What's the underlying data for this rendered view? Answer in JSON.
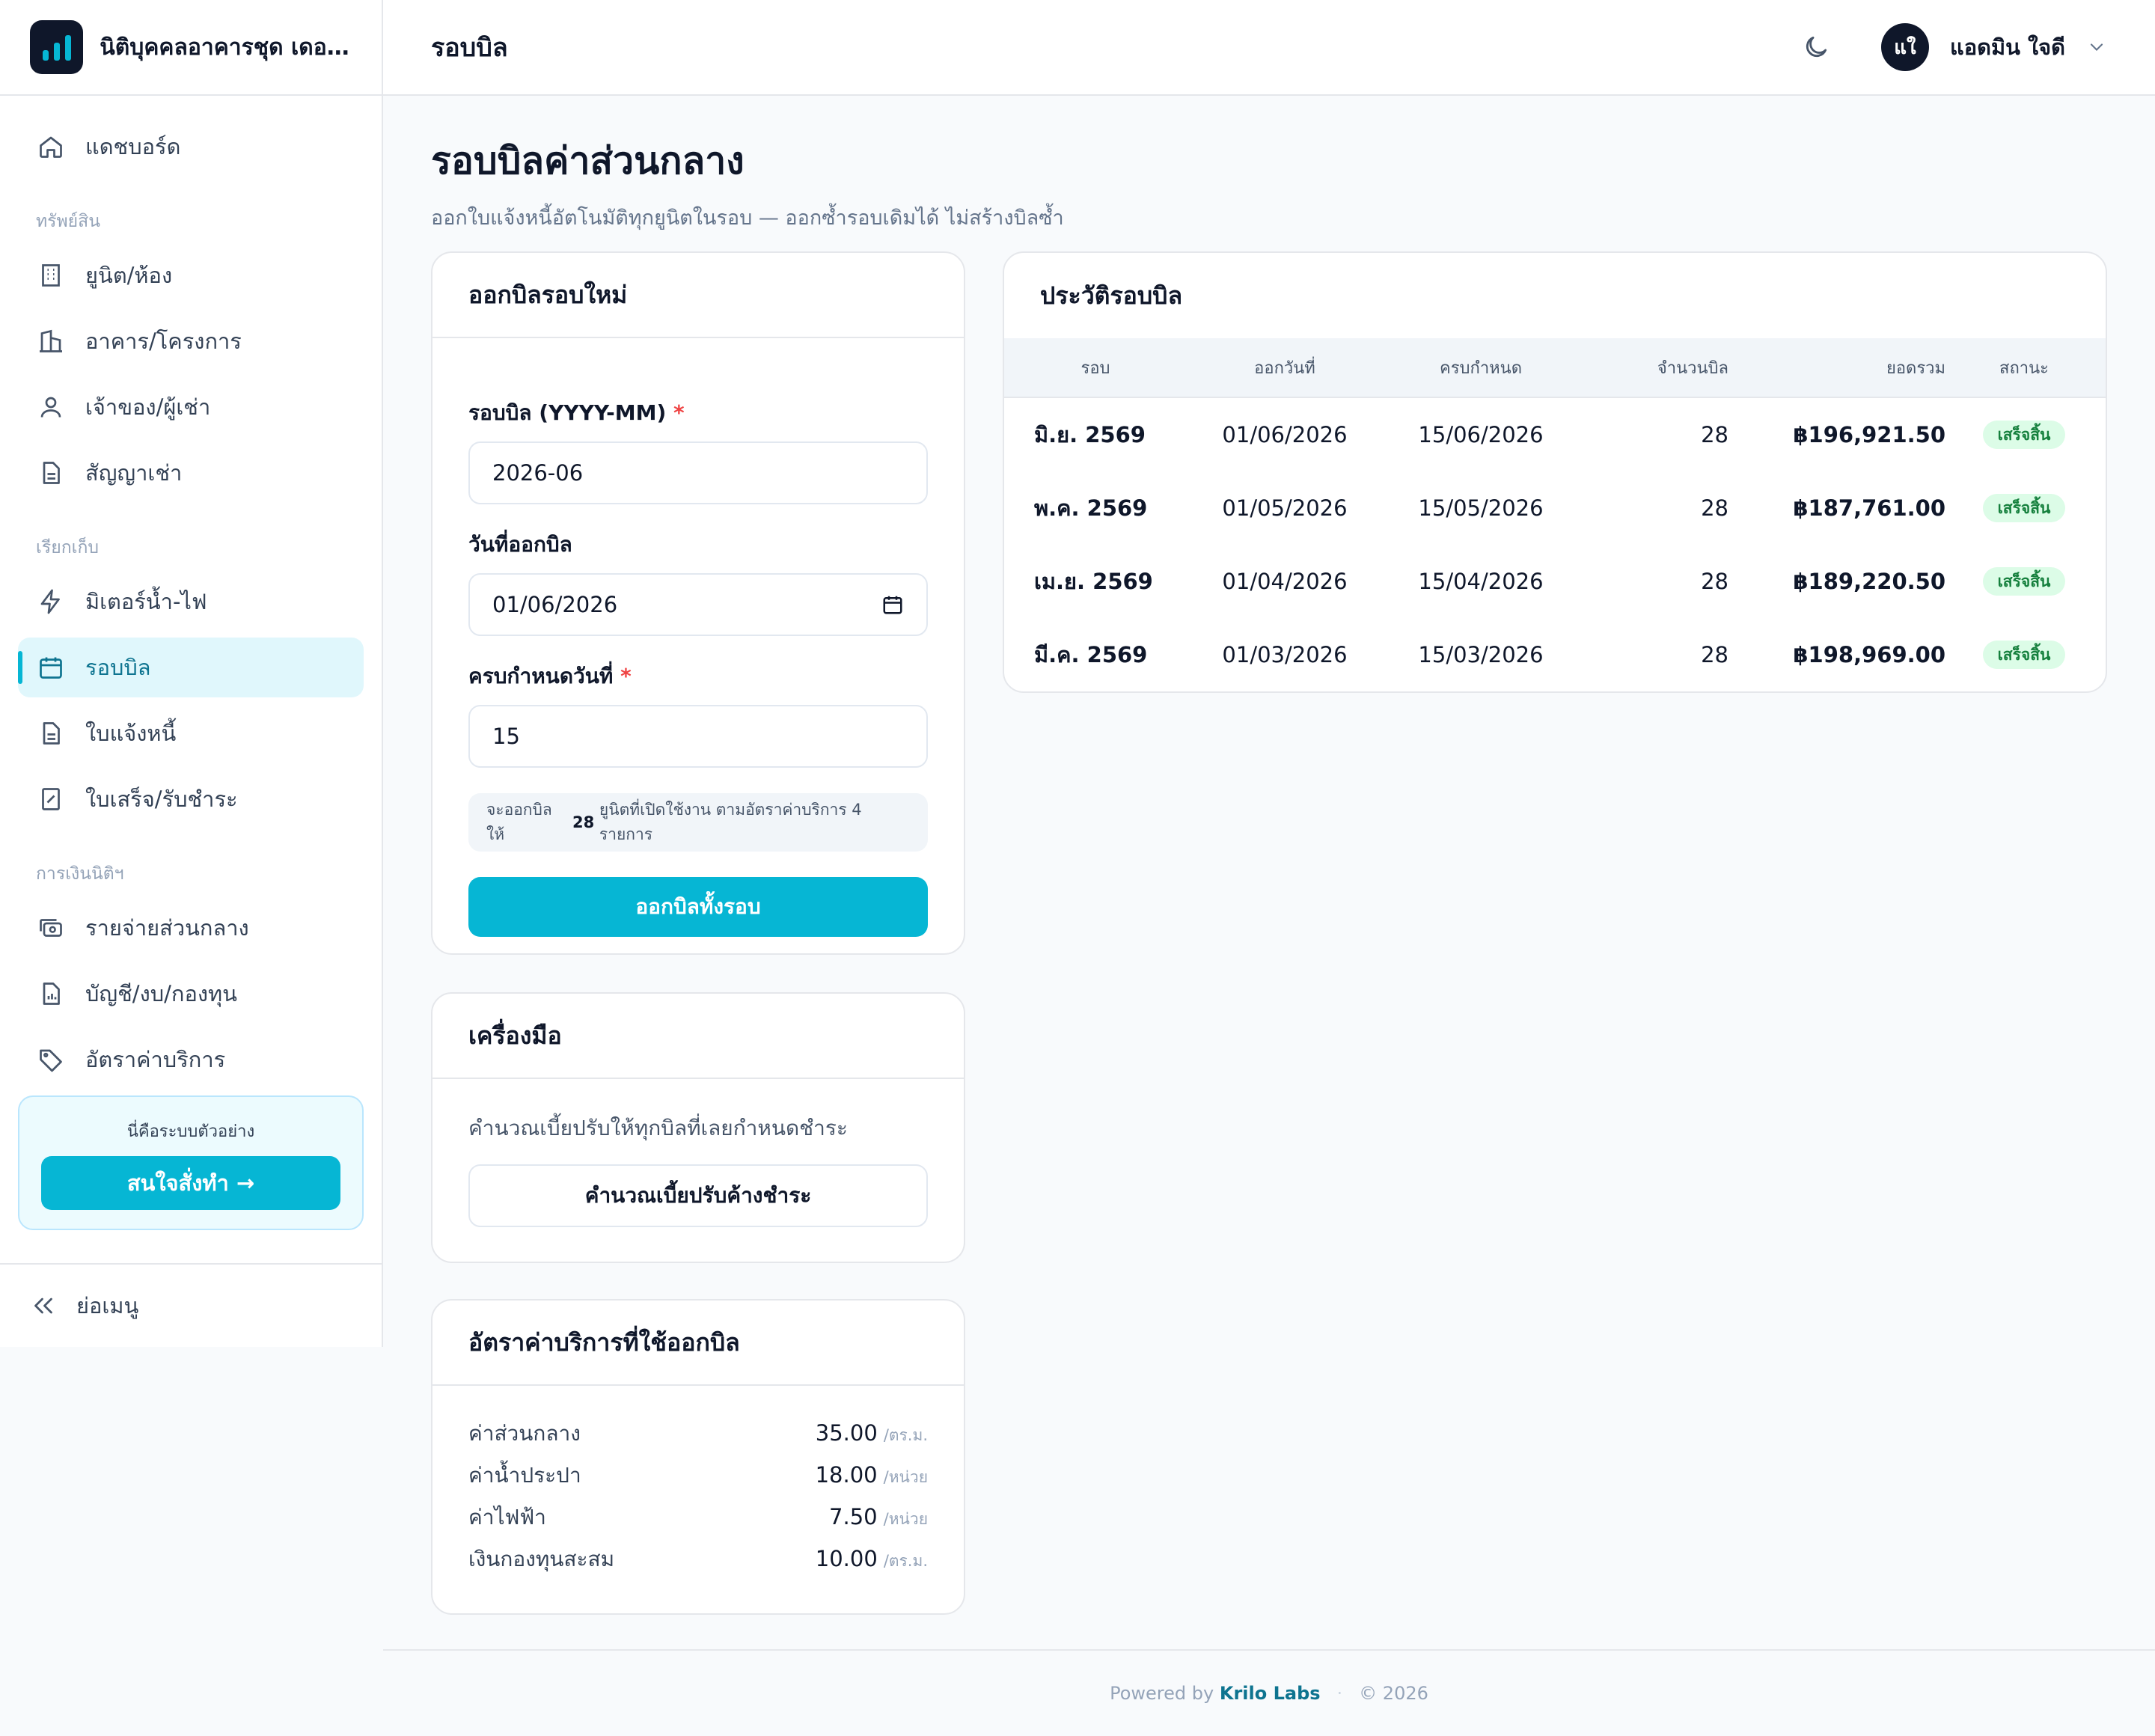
{
  "app": {
    "org_name": "นิติบุคคลอาคารชุด เดอะ ...",
    "logo_icon": "bar-chart-icon",
    "accent_color": "#06b6d4",
    "dark_color": "#0f172a"
  },
  "sidebar": {
    "items_top": [
      {
        "label": "แดชบอร์ด",
        "icon": "home-icon"
      }
    ],
    "section_assets": "ทรัพย์สิน",
    "items_assets": [
      {
        "label": "ยูนิต/ห้อง",
        "icon": "building-icon"
      },
      {
        "label": "อาคาร/โครงการ",
        "icon": "buildings-icon"
      },
      {
        "label": "เจ้าของ/ผู้เช่า",
        "icon": "user-icon"
      },
      {
        "label": "สัญญาเช่า",
        "icon": "document-icon"
      }
    ],
    "section_billing": "เรียกเก็บ",
    "items_billing": [
      {
        "label": "มิเตอร์น้ำ-ไฟ",
        "icon": "bolt-icon"
      },
      {
        "label": "รอบบิล",
        "icon": "calendar-icon",
        "active": true
      },
      {
        "label": "ใบแจ้งหนี้",
        "icon": "document-icon"
      },
      {
        "label": "ใบเสร็จ/รับชำระ",
        "icon": "receipt-icon"
      }
    ],
    "section_finance": "การเงินนิติฯ",
    "items_finance": [
      {
        "label": "รายจ่ายส่วนกลาง",
        "icon": "cash-icon"
      },
      {
        "label": "บัญชี/งบ/กองทุน",
        "icon": "report-icon"
      },
      {
        "label": "อัตราค่าบริการ",
        "icon": "tag-icon"
      }
    ],
    "promo_text": "นี่คือระบบตัวอย่าง",
    "promo_button": "สนใจสั่งทำ →",
    "collapse_label": "ย่อเมนู"
  },
  "topbar": {
    "title": "รอบบิล",
    "theme_icon": "moon-icon",
    "avatar_initials": "แใ",
    "user_name": "แอดมิน ใจดี"
  },
  "page": {
    "title": "รอบบิลค่าส่วนกลาง",
    "subtitle": "ออกใบแจ้งหนี้อัตโนมัติทุกยูนิตในรอบ — ออกซ้ำรอบเดิมได้ ไม่สร้างบิลซ้ำ"
  },
  "new_cycle": {
    "title": "ออกบิลรอบใหม่",
    "period_label": "รอบบิล (YYYY-MM)",
    "period_value": "2026-06",
    "issue_label": "วันที่ออกบิล",
    "issue_value": "01/06/2026",
    "due_label": "ครบกำหนดวันที่",
    "due_value": "15",
    "note_prefix": "จะออกบิลให้",
    "note_count": "28",
    "note_suffix": "ยูนิตที่เปิดใช้งาน ตามอัตราค่าบริการ 4 รายการ",
    "submit": "ออกบิลทั้งรอบ"
  },
  "tools": {
    "title": "เครื่องมือ",
    "description": "คำนวณเบี้ยปรับให้ทุกบิลที่เลยกำหนดชำระ",
    "button": "คำนวณเบี้ยปรับค้างชำระ"
  },
  "rates": {
    "title": "อัตราค่าบริการที่ใช้ออกบิล",
    "items": [
      {
        "name": "ค่าส่วนกลาง",
        "value": "35.00",
        "unit": "/ตร.ม."
      },
      {
        "name": "ค่าน้ำประปา",
        "value": "18.00",
        "unit": "/หน่วย"
      },
      {
        "name": "ค่าไฟฟ้า",
        "value": "7.50",
        "unit": "/หน่วย"
      },
      {
        "name": "เงินกองทุนสะสม",
        "value": "10.00",
        "unit": "/ตร.ม."
      }
    ]
  },
  "history": {
    "title": "ประวัติรอบบิล",
    "columns": [
      "รอบ",
      "ออกวันที่",
      "ครบกำหนด",
      "จำนวนบิล",
      "ยอดรวม",
      "สถานะ"
    ],
    "rows": [
      {
        "period": "มิ.ย. 2569",
        "issued": "01/06/2026",
        "due": "15/06/2026",
        "count": "28",
        "total": "฿196,921.50",
        "status": "เสร็จสิ้น"
      },
      {
        "period": "พ.ค. 2569",
        "issued": "01/05/2026",
        "due": "15/05/2026",
        "count": "28",
        "total": "฿187,761.00",
        "status": "เสร็จสิ้น"
      },
      {
        "period": "เม.ย. 2569",
        "issued": "01/04/2026",
        "due": "15/04/2026",
        "count": "28",
        "total": "฿189,220.50",
        "status": "เสร็จสิ้น"
      },
      {
        "period": "มี.ค. 2569",
        "issued": "01/03/2026",
        "due": "15/03/2026",
        "count": "28",
        "total": "฿198,969.00",
        "status": "เสร็จสิ้น"
      }
    ]
  },
  "footer": {
    "powered_by": "Powered by",
    "brand": "Krilo Labs",
    "separator": "·",
    "copyright": "© 2026"
  }
}
